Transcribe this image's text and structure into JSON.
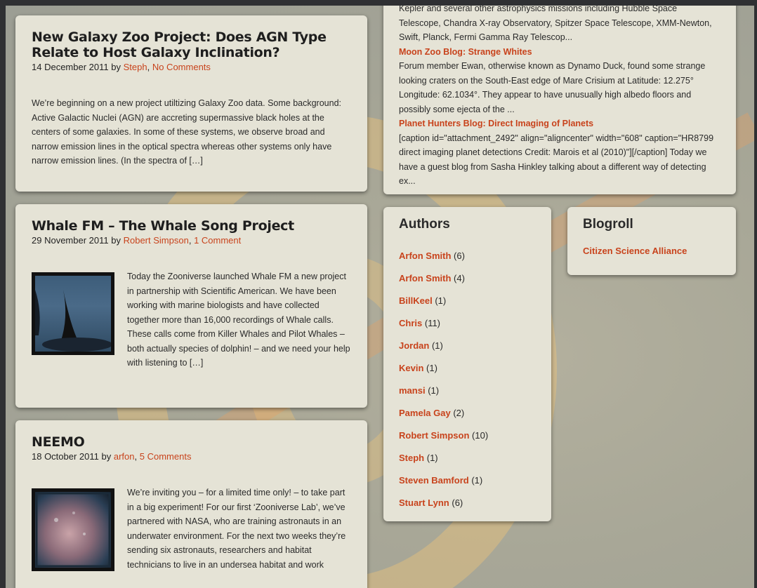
{
  "posts": [
    {
      "title": "New Galaxy Zoo Project: Does AGN Type Relate to Host Galaxy Inclination?",
      "date": "14 December 2011",
      "by": "by",
      "author": "Steph",
      "separator": ",",
      "comments": "No Comments",
      "excerpt": "We’re beginning on a new project utiltizing Galaxy Zoo data. Some background: Active Galactic Nuclei (AGN) are accreting supermassive black holes at the centers of some galaxies. In some of these systems, we observe broad and narrow emission lines in the optical spectra whereas other systems only have narrow emission lines. (In the spectra of […]"
    },
    {
      "title": "Whale FM – The Whale Song Project",
      "date": "29 November 2011",
      "by": "by",
      "author": "Robert Simpson",
      "separator": ",",
      "comments": "1 Comment",
      "excerpt": "Today the Zooniverse launched Whale FM a new project in partnership with Scientific American. We have been working with marine biologists and have collected together more than 16,000 recordings of Whale calls. These calls come from Killer Whales and Pilot Whales – both actually species of dolphin! – and we need your help with listening to […]"
    },
    {
      "title": "NEEMO",
      "date": "18 October 2011",
      "by": "by",
      "author": "arfon",
      "separator": ",",
      "comments": "5 Comments",
      "excerpt": "We’re inviting you – for a limited time only! – to take part in a big experiment! For our first ‘Zooniverse Lab’, we’ve partnered with NASA, who are training astronauts in an underwater environment. For the next two weeks they’re sending six astronauts, researchers and habitat technicians to live in an undersea habitat and work"
    }
  ],
  "feed": {
    "top_text": "Kepler and several other astrophysics missions including Hubble Space Telescope, Chandra X-ray Observatory, Spitzer Space Telescope, XMM-Newton, Swift, Planck, Fermi Gamma Ray Telescop...",
    "items": [
      {
        "title": "Moon Zoo Blog: Strange Whites",
        "text": "Forum member Ewan, otherwise known as Dynamo Duck, found some strange looking craters on the South-East edge of Mare Crisium at Latitude: 12.275° Longitude: 62.1034°. They appear to have unusually high albedo floors and possibly some ejecta of the ..."
      },
      {
        "title": "Planet Hunters Blog: Direct Imaging of Planets",
        "text": "[caption id=\"attachment_2492\" align=\"aligncenter\" width=\"608\" caption=\"HR8799 direct imaging planet detections Credit: Marois et al (2010)\"][/caption] Today we have a guest blog from Sasha Hinkley talking about a different way of detecting ex..."
      }
    ]
  },
  "authors": {
    "heading": "Authors",
    "items": [
      {
        "name": "Arfon Smith",
        "count": "(6)"
      },
      {
        "name": "Arfon Smith",
        "count": "(4)"
      },
      {
        "name": "BillKeel",
        "count": "(1)"
      },
      {
        "name": "Chris",
        "count": "(11)"
      },
      {
        "name": "Jordan",
        "count": "(1)"
      },
      {
        "name": "Kevin",
        "count": "(1)"
      },
      {
        "name": "mansi",
        "count": "(1)"
      },
      {
        "name": "Pamela Gay",
        "count": "(2)"
      },
      {
        "name": "Robert Simpson",
        "count": "(10)"
      },
      {
        "name": "Steph",
        "count": "(1)"
      },
      {
        "name": "Steven Bamford",
        "count": "(1)"
      },
      {
        "name": "Stuart Lynn",
        "count": "(6)"
      }
    ]
  },
  "blogroll": {
    "heading": "Blogroll",
    "link": "Citizen Science Alliance"
  },
  "colors": {
    "link": "#c8431c",
    "card": "#e5e3d6",
    "swirl": "#e8c27a"
  },
  "icons": [
    "whale-thumbnail",
    "neemo-thumbnail"
  ]
}
